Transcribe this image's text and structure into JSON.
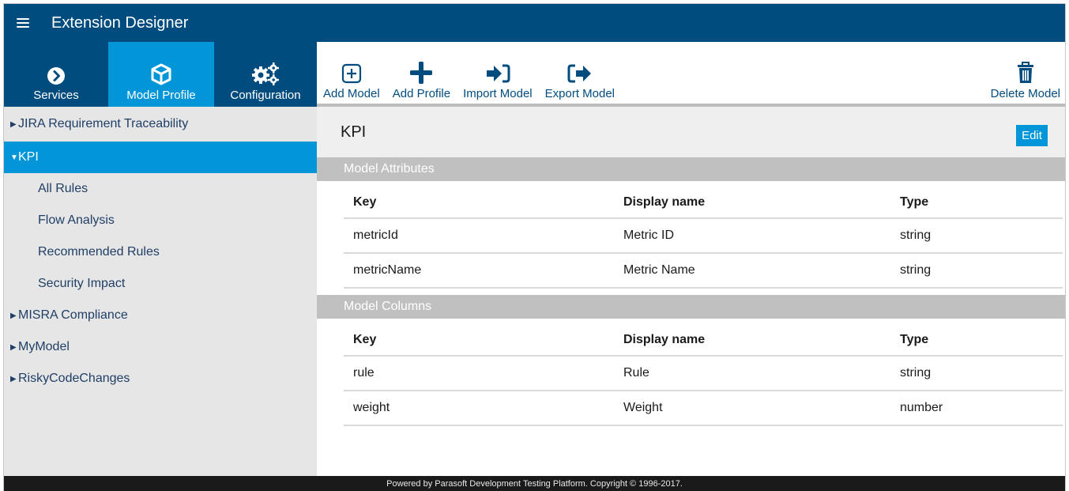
{
  "header": {
    "title": "Extension Designer"
  },
  "tabs": [
    {
      "label": "Services",
      "icon": "chevron-right-circle-icon"
    },
    {
      "label": "Model Profile",
      "icon": "cube-icon"
    },
    {
      "label": "Configuration",
      "icon": "gears-icon"
    }
  ],
  "toolbar": {
    "add_model": "Add Model",
    "add_profile": "Add Profile",
    "import_model": "Import Model",
    "export_model": "Export Model",
    "delete_model": "Delete Model"
  },
  "sidebar": {
    "items": [
      {
        "label": "JIRA Requirement Traceability"
      },
      {
        "label": "KPI"
      },
      {
        "label": "MISRA Compliance"
      },
      {
        "label": "MyModel"
      },
      {
        "label": "RiskyCodeChanges"
      }
    ],
    "kpi_children": [
      "All Rules",
      "Flow Analysis",
      "Recommended Rules",
      "Security Impact"
    ]
  },
  "main": {
    "title": "KPI",
    "edit_label": "Edit",
    "attributes": {
      "heading": "Model Attributes",
      "columns": [
        "Key",
        "Display name",
        "Type"
      ],
      "rows": [
        [
          "metricId",
          "Metric ID",
          "string"
        ],
        [
          "metricName",
          "Metric Name",
          "string"
        ]
      ]
    },
    "model_columns": {
      "heading": "Model Columns",
      "columns": [
        "Key",
        "Display name",
        "Type"
      ],
      "rows": [
        [
          "rule",
          "Rule",
          "string"
        ],
        [
          "weight",
          "Weight",
          "number"
        ]
      ]
    }
  },
  "footer": {
    "text": "Powered by Parasoft Development Testing Platform. Copyright © 1996-2017."
  },
  "colors": {
    "header": "#004c7f",
    "accent": "#0296d8",
    "sidebar": "#e6e6e6",
    "section": "#c0c0c0"
  }
}
